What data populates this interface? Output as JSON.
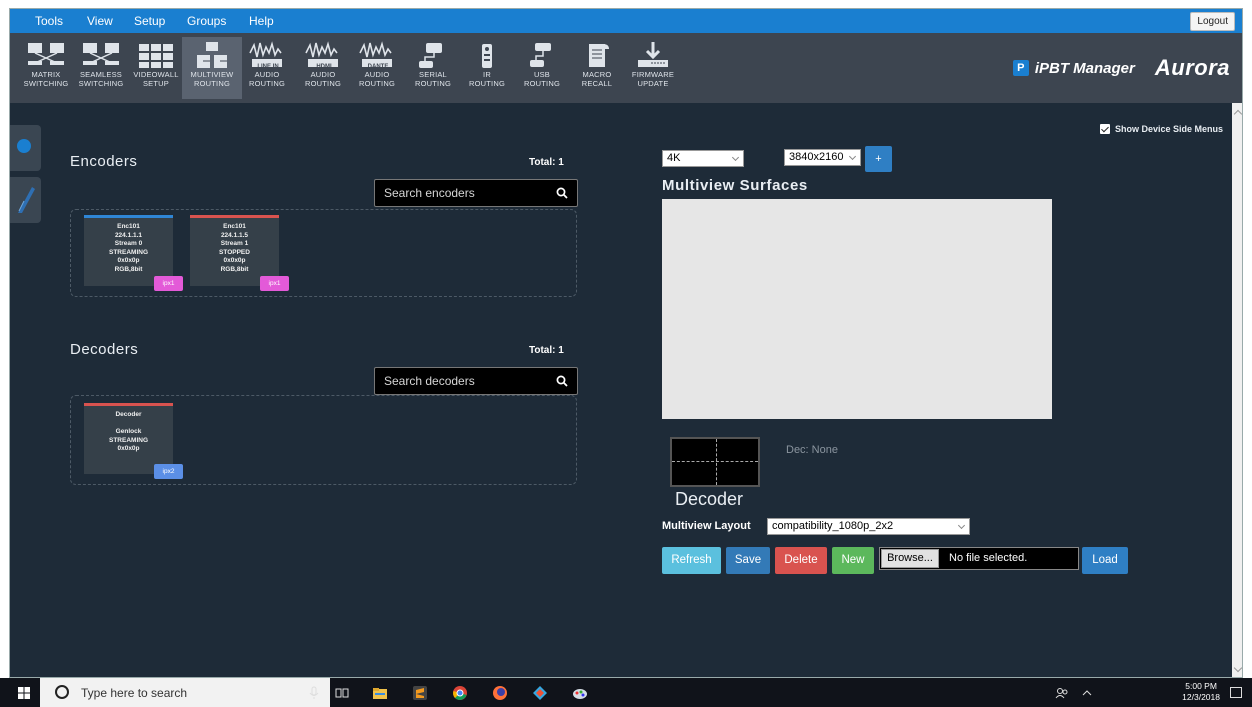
{
  "menu": [
    "Tools",
    "View",
    "Setup",
    "Groups",
    "Help"
  ],
  "logout_label": "Logout",
  "toolbar": [
    {
      "l1": "MATRIX",
      "l2": "SWITCHING",
      "icon": "matrix-switching-icon"
    },
    {
      "l1": "SEAMLESS",
      "l2": "SWITCHING",
      "icon": "seamless-switching-icon"
    },
    {
      "l1": "VIDEOWALL",
      "l2": "SETUP",
      "icon": "videowall-icon"
    },
    {
      "l1": "MULTIVIEW",
      "l2": "ROUTING",
      "icon": "multiview-icon",
      "active": true
    },
    {
      "l1": "AUDIO",
      "l2": "ROUTING",
      "tag": "LINE IN",
      "icon": "line-in-audio-icon"
    },
    {
      "l1": "AUDIO",
      "l2": "ROUTING",
      "tag": "HDMI",
      "icon": "hdmi-audio-icon"
    },
    {
      "l1": "AUDIO",
      "l2": "ROUTING",
      "tag": "DANTE",
      "icon": "dante-audio-icon"
    },
    {
      "l1": "SERIAL",
      "l2": "ROUTING",
      "icon": "serial-icon"
    },
    {
      "l1": "IR",
      "l2": "ROUTING",
      "icon": "ir-remote-icon"
    },
    {
      "l1": "USB",
      "l2": "ROUTING",
      "icon": "usb-icon"
    },
    {
      "l1": "MACRO",
      "l2": "RECALL",
      "icon": "macro-icon"
    },
    {
      "l1": "FIRMWARE",
      "l2": "UPDATE",
      "icon": "firmware-icon"
    }
  ],
  "brand": {
    "logo_letter": "P",
    "name": "iPBT Manager",
    "company": "Aurora"
  },
  "show_side_menus": "Show Device Side Menus",
  "encoders": {
    "title": "Encoders",
    "total": "Total: 1",
    "search_placeholder": "Search encoders",
    "cards": [
      {
        "lines": [
          "Enc101",
          "224.1.1.1",
          "Stream 0",
          "STREAMING",
          "0x0x0p",
          "RGB,8bit"
        ],
        "badge": "ipx1",
        "bar_color": "#2f86d6"
      },
      {
        "lines": [
          "Enc101",
          "224.1.1.5",
          "Stream 1",
          "STOPPED",
          "0x0x0p",
          "RGB,8bit"
        ],
        "badge": "ipx1",
        "bar_color": "#d9534f"
      }
    ]
  },
  "decoders": {
    "title": "Decoders",
    "total": "Total: 1",
    "search_placeholder": "Search decoders",
    "cards": [
      {
        "lines": [
          "Decoder",
          "",
          "Genlock",
          "STREAMING",
          "0x0x0p"
        ],
        "badge": "ipx2",
        "bar_color": "#d9534f"
      }
    ]
  },
  "multiview": {
    "resolution_class": "4K",
    "resolution": "3840x2160",
    "add_label": "+",
    "title": "Multiview Surfaces",
    "decoder_label": "Decoder",
    "dec_none": "Dec: None",
    "layout_label": "Multiview Layout",
    "layout_value": "compatibility_1080p_2x2",
    "buttons": {
      "refresh": "Refresh",
      "save": "Save",
      "delete": "Delete",
      "new": "New",
      "load": "Load"
    },
    "browse_label": "Browse...",
    "file_status": "No file selected."
  },
  "taskbar": {
    "search_placeholder": "Type here to search",
    "time": "5:00 PM",
    "date": "12/3/2018"
  },
  "colors": {
    "menubar": "#1a7fd0",
    "toolbar": "#3d4550",
    "content_bg": "#1e2b38",
    "badge_pink": "#e35ad8",
    "badge_blue": "#5b8fe6",
    "refresh": "#5bc0de",
    "save": "#337ab7",
    "delete": "#d9534f",
    "new": "#5cb85c"
  }
}
